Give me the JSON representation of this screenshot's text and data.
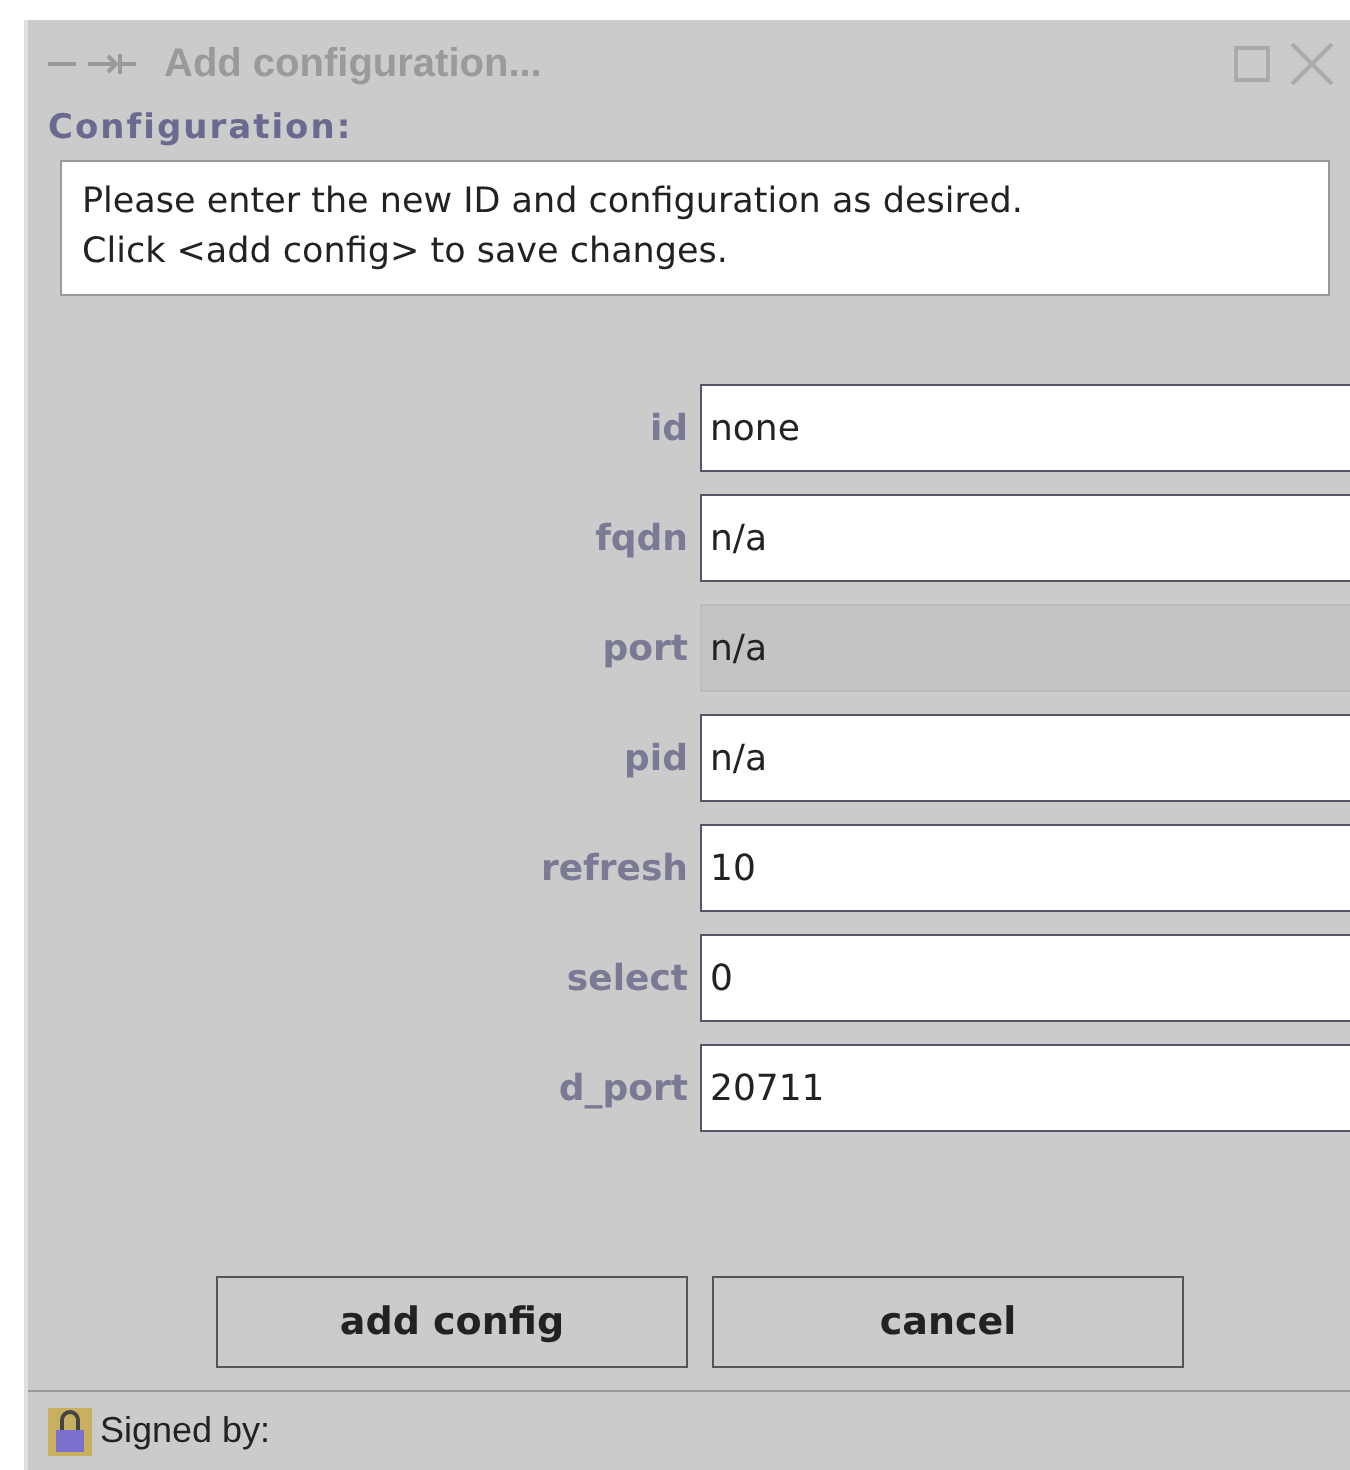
{
  "window": {
    "title": "Add configuration..."
  },
  "group": {
    "title": "Configuration:",
    "message": "Please enter the new ID and configuration as desired.\nClick <add config> to save changes."
  },
  "fields": [
    {
      "label": "id",
      "value": "none",
      "disabled": false
    },
    {
      "label": "fqdn",
      "value": "n/a",
      "disabled": false
    },
    {
      "label": "port",
      "value": "n/a",
      "disabled": true
    },
    {
      "label": "pid",
      "value": "n/a",
      "disabled": false
    },
    {
      "label": "refresh",
      "value": "10",
      "disabled": false
    },
    {
      "label": "select",
      "value": "0",
      "disabled": false
    },
    {
      "label": "d_port",
      "value": "20711",
      "disabled": false
    }
  ],
  "buttons": [
    "add config",
    "cancel"
  ],
  "status_bar": {
    "text": "Signed by:"
  }
}
